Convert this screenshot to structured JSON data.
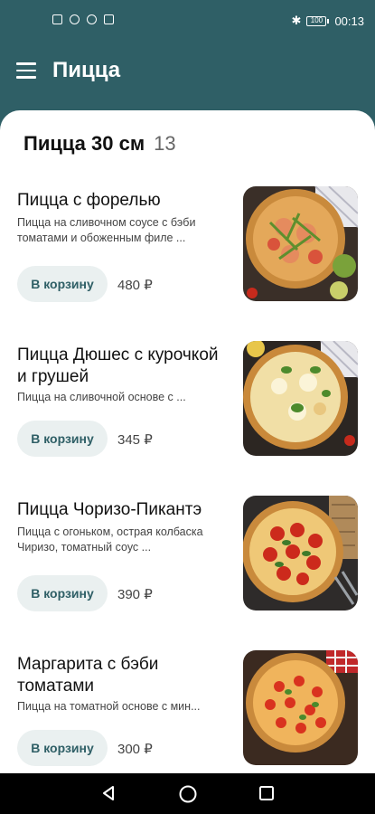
{
  "status_bar": {
    "left_icons": [
      "sim-icon",
      "wifi-icon",
      "usb-icon",
      "mail-icon"
    ],
    "bluetooth_icon": "bluetooth-icon",
    "battery_text": "100",
    "time": "00:13"
  },
  "app_bar": {
    "title": "Пицца",
    "menu_icon": "hamburger-menu-icon"
  },
  "section": {
    "title": "Пицца 30 см",
    "count": "13"
  },
  "products": [
    {
      "name": "Пицца с форелью",
      "description": "Пицца на сливочном соусе с бэби томатами и обоженным филе ...",
      "button": "В корзину",
      "price": "480 ₽",
      "image": "trout-pizza-photo"
    },
    {
      "name": "Пицца Дюшес с курочкой и грушей",
      "description": "Пицца на сливочной основе с ...",
      "button": "В корзину",
      "price": "345 ₽",
      "image": "chicken-pear-pizza-photo"
    },
    {
      "name": "Пицца Чоризо-Пикантэ",
      "description": "Пицца с огоньком, острая колбаска Чиризо, томатный соус ...",
      "button": "В корзину",
      "price": "390 ₽",
      "image": "chorizo-pizza-photo"
    },
    {
      "name": "Маргарита с бэби томатами",
      "description": "Пицца на томатной основе с мин...",
      "button": "В корзину",
      "price": "300 ₽",
      "image": "margherita-pizza-photo"
    }
  ],
  "colors": {
    "primary": "#2f5f66",
    "button_bg": "#eaf0f0",
    "button_text": "#2f5f66"
  },
  "nav_bar": {
    "icons": [
      "back-icon",
      "home-icon",
      "recent-apps-icon"
    ]
  }
}
